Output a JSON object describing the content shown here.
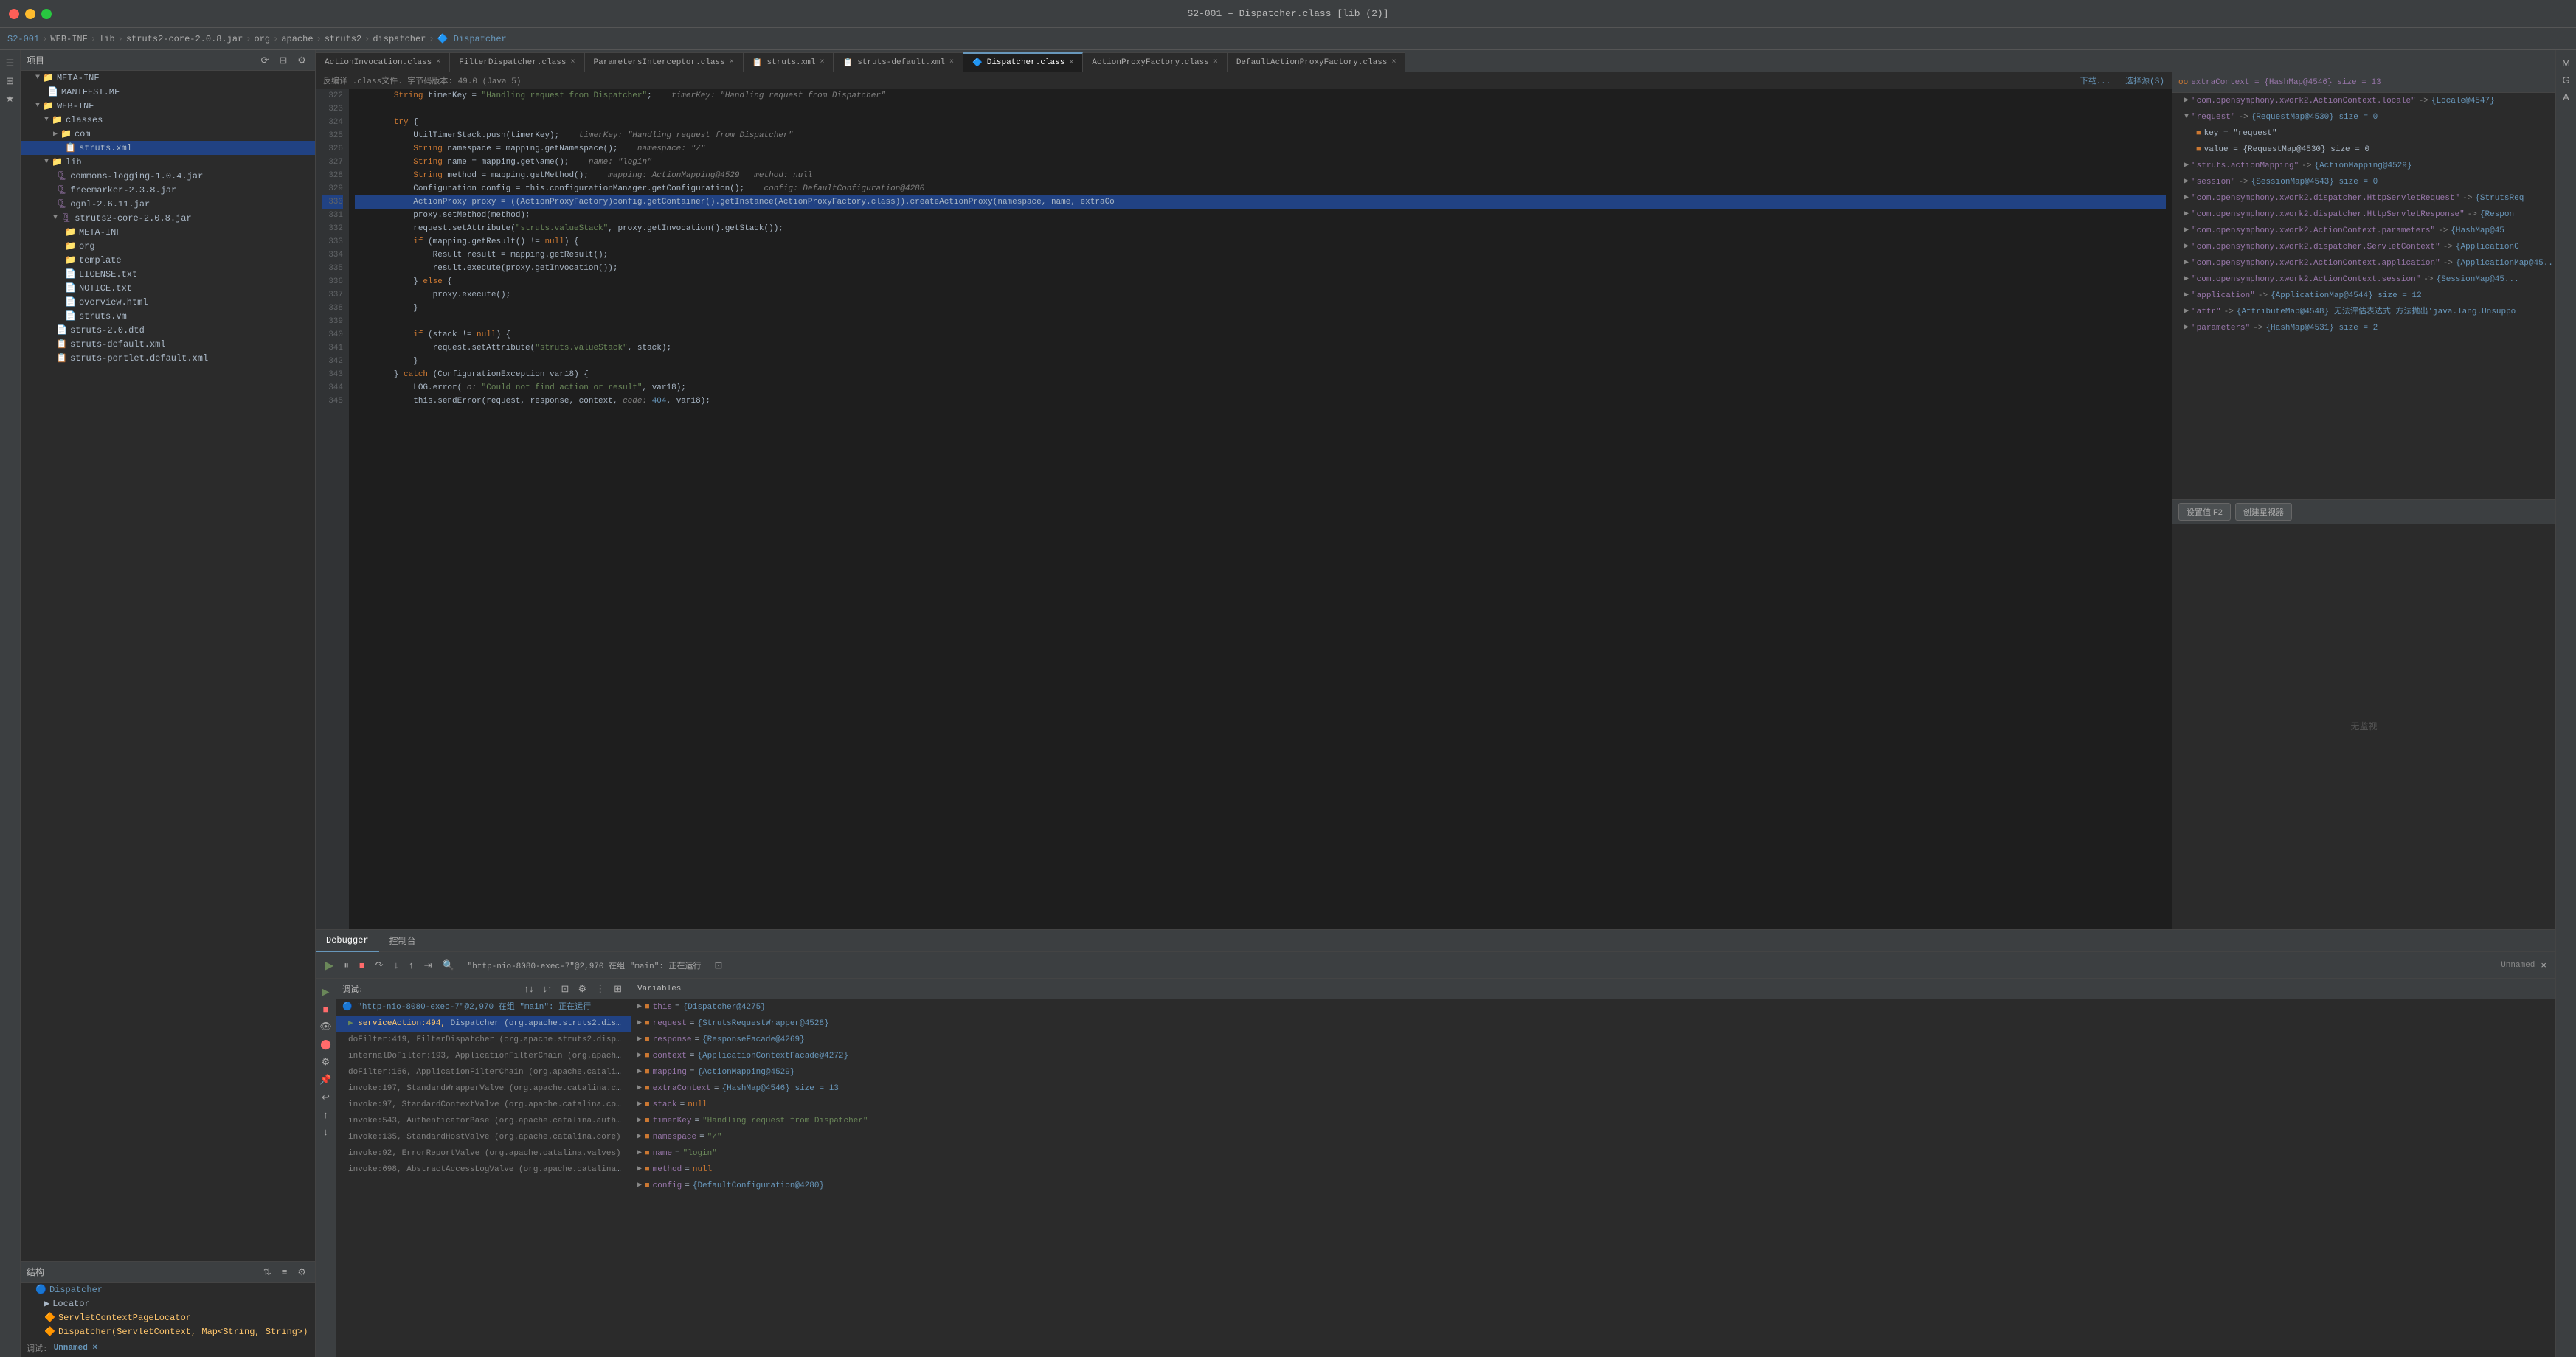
{
  "window": {
    "title": "S2-001 – Dispatcher.class [lib (2)]"
  },
  "breadcrumb": {
    "items": [
      "S2-001",
      "WEB-INF",
      "lib",
      "struts2-core-2.0.8.jar",
      "org",
      "apache",
      "struts2",
      "dispatcher",
      "Dispatcher"
    ]
  },
  "tabs": [
    {
      "label": "ActionInvocation.class",
      "active": false,
      "closeable": true
    },
    {
      "label": "FilterDispatcher.class",
      "active": false,
      "closeable": true
    },
    {
      "label": "ParametersInterceptor.class",
      "active": false,
      "closeable": true
    },
    {
      "label": "struts.xml",
      "active": false,
      "closeable": true
    },
    {
      "label": "struts-default.xml",
      "active": false,
      "closeable": true
    },
    {
      "label": "Dispatcher.class",
      "active": true,
      "closeable": true
    },
    {
      "label": "ActionProxyFactory.class",
      "active": false,
      "closeable": true
    },
    {
      "label": "DefaultActionProxyFactory.class",
      "active": false,
      "closeable": true
    }
  ],
  "editor": {
    "info_bar": "反编译 .class文件. 字节码版本: 49.0 (Java 5)",
    "info_bar_right": "下载...   选择源(S)",
    "lines": [
      {
        "num": 322,
        "content": "        String timerKey = \"Handling request from Dispatcher\";    timerKey: \"Handling request from Dispatcher\"",
        "highlight": false
      },
      {
        "num": 323,
        "content": "",
        "highlight": false
      },
      {
        "num": 324,
        "content": "        try {",
        "highlight": false
      },
      {
        "num": 325,
        "content": "            UtilTimerStack.push(timerKey);    timerKey: \"Handling request from Dispatcher\"",
        "highlight": false
      },
      {
        "num": 326,
        "content": "            String namespace = mapping.getNamespace();    namespace: \"/\"",
        "highlight": false
      },
      {
        "num": 327,
        "content": "            String name = mapping.getName();    name: \"login\"",
        "highlight": false
      },
      {
        "num": 328,
        "content": "            String method = mapping.getMethod();    mapping: ActionMapping@4529   method: null",
        "highlight": false
      },
      {
        "num": 329,
        "content": "            Configuration config = this.configurationManager.getConfiguration();    config: DefaultConfiguration@4280",
        "highlight": false
      },
      {
        "num": 330,
        "content": "            ActionProxy proxy = ((ActionProxyFactory)config.getContainer().getInstance(ActionProxyFactory.class)).createActionProxy(namespace, name, extraCo",
        "highlight": true
      },
      {
        "num": 331,
        "content": "            proxy.setMethod(method);",
        "highlight": false
      },
      {
        "num": 332,
        "content": "            request.setAttribute(\"struts.valueStack\", proxy.getInvocation().getStack());",
        "highlight": false
      },
      {
        "num": 333,
        "content": "            if (mapping.getResult() != null) {",
        "highlight": false
      },
      {
        "num": 334,
        "content": "                Result result = mapping.getResult();",
        "highlight": false
      },
      {
        "num": 335,
        "content": "                result.execute(proxy.getInvocation());",
        "highlight": false
      },
      {
        "num": 336,
        "content": "            } else {",
        "highlight": false
      },
      {
        "num": 337,
        "content": "                proxy.execute();",
        "highlight": false
      },
      {
        "num": 338,
        "content": "            }",
        "highlight": false
      },
      {
        "num": 339,
        "content": "",
        "highlight": false
      },
      {
        "num": 340,
        "content": "            if (stack != null) {",
        "highlight": false
      },
      {
        "num": 341,
        "content": "                request.setAttribute(\"struts.valueStack\", stack);",
        "highlight": false
      },
      {
        "num": 342,
        "content": "            }",
        "highlight": false
      },
      {
        "num": 343,
        "content": "        } catch (ConfigurationException var18) {",
        "highlight": false
      },
      {
        "num": 344,
        "content": "            LOG.error( o: \"Could not find action or result\", var18);",
        "highlight": false
      },
      {
        "num": 345,
        "content": "            this.sendError(request, response, context, code: 404, var18);",
        "highlight": false
      }
    ]
  },
  "debug_panel": {
    "header": "oo extraContext = {HashMap@4546} size = 13",
    "items": [
      {
        "indent": 0,
        "expanded": true,
        "key": "oo extraContext = {HashMap@4546} size = 13",
        "value": ""
      },
      {
        "indent": 1,
        "expanded": false,
        "key": "\"com.opensymphony.xwork2.ActionContext.locale\"",
        "value": "-> {Locale@4547}"
      },
      {
        "indent": 1,
        "expanded": true,
        "key": "\"request\"",
        "value": "-> {RequestMap@4530} size = 0"
      },
      {
        "indent": 2,
        "expanded": false,
        "key": "key = \"request\"",
        "value": ""
      },
      {
        "indent": 2,
        "expanded": false,
        "key": "value = {RequestMap@4530} size = 0",
        "value": ""
      },
      {
        "indent": 1,
        "expanded": false,
        "key": "\"struts.actionMapping\"",
        "value": "-> {ActionMapping@4529}"
      },
      {
        "indent": 1,
        "expanded": false,
        "key": "\"session\"",
        "value": "-> {SessionMap@4543} size = 0"
      },
      {
        "indent": 1,
        "expanded": false,
        "key": "\"com.opensymphony.xwork2.dispatcher.HttpServletRequest\"",
        "value": "-> {StrutsReq"
      },
      {
        "indent": 1,
        "expanded": false,
        "key": "\"com.opensymphony.xwork2.dispatcher.HttpServletResponse\"",
        "value": "-> {Respon"
      },
      {
        "indent": 1,
        "expanded": false,
        "key": "\"com.opensymphony.xwork2.ActionContext.parameters\"",
        "value": "-> {HashMap@45"
      },
      {
        "indent": 1,
        "expanded": false,
        "key": "\"com.opensymphony.xwork2.dispatcher.ServletContext\"",
        "value": "-> {ApplicationC"
      },
      {
        "indent": 1,
        "expanded": false,
        "key": "\"com.opensymphony.xwork2.ActionContext.application\"",
        "value": "-> {ApplicationMap@45..."
      },
      {
        "indent": 1,
        "expanded": false,
        "key": "\"com.opensymphony.xwork2.ActionContext.session\"",
        "value": "-> {SessionMap@45..."
      },
      {
        "indent": 1,
        "expanded": false,
        "key": "\"application\"",
        "value": "-> {ApplicationMap@4544} size = 12"
      },
      {
        "indent": 1,
        "expanded": false,
        "key": "\"attr\"",
        "value": "-> {AttributeMap@4548} 无法评估表达式 方法抛出'java.lang.Unsuppo"
      },
      {
        "indent": 1,
        "expanded": false,
        "key": "\"parameters\"",
        "value": "-> {HashMap@4531} size = 2"
      }
    ],
    "actions": [
      {
        "label": "设置值 F2"
      },
      {
        "label": "创建星视器"
      }
    ]
  },
  "bottom_panel": {
    "tabs": [
      "Debugger",
      "控制台"
    ],
    "active_tab": "Debugger",
    "debug_toolbar": {
      "thread_label": "\"http-nio-8080-exec-7\"@2,970 在组 \"main\": 正在运行"
    },
    "call_stack": {
      "items": [
        {
          "method": "serviceAction:494",
          "class": "Dispatcher (org.apache.struts2.dispatcher)",
          "selected": true
        },
        {
          "method": "doFilter:419",
          "class": "FilterDispatcher (org.apache.struts2.dispatcher)",
          "selected": false
        },
        {
          "method": "internalDoFilter:193",
          "class": "ApplicationFilterChain (org.apache.catalina.co...",
          "selected": false
        },
        {
          "method": "doFilter:166",
          "class": "ApplicationFilterChain (org.apache.catalina.core)",
          "selected": false
        },
        {
          "method": "invoke:197",
          "class": "StandardWrapperValve (org.apache.catalina.core)",
          "selected": false
        },
        {
          "method": "invoke:97",
          "class": "StandardContextValve (org.apache.catalina.core)",
          "selected": false
        },
        {
          "method": "invoke:543",
          "class": "AuthenticatorBase (org.apache.catalina.authenticator)",
          "selected": false
        },
        {
          "method": "invoke:135",
          "class": "StandardHostValve (org.apache.catalina.core)",
          "selected": false
        },
        {
          "method": "invoke:92",
          "class": "ErrorReportValve (org.apache.catalina.valves)",
          "selected": false
        },
        {
          "method": "invoke:698",
          "class": "AbstractAccessLogValve (org.apache.catalina.valves)",
          "selected": false
        }
      ]
    },
    "variables": {
      "items": [
        {
          "indent": 0,
          "name": "this",
          "value": "= {Dispatcher@4275}"
        },
        {
          "indent": 0,
          "name": "request",
          "value": "= {StrutsRequestWrapper@4528}"
        },
        {
          "indent": 0,
          "name": "response",
          "value": "= {ResponseFacade@4269}"
        },
        {
          "indent": 0,
          "name": "context",
          "value": "= {ApplicationContextFacade@4272}"
        },
        {
          "indent": 0,
          "name": "mapping",
          "value": "= {ActionMapping@4529}"
        },
        {
          "indent": 0,
          "name": "extraContext",
          "value": "= {HashMap@4546} size = 13"
        },
        {
          "indent": 0,
          "name": "stack",
          "value": "= null"
        },
        {
          "indent": 0,
          "name": "timerKey",
          "value": "= \"Handling request from Dispatcher\""
        },
        {
          "indent": 0,
          "name": "namespace",
          "value": "= \"/\""
        },
        {
          "indent": 0,
          "name": "name",
          "value": "= \"login\""
        },
        {
          "indent": 0,
          "name": "method",
          "value": "= null"
        },
        {
          "indent": 0,
          "name": "config",
          "value": "= {DefaultConfiguration@4280}"
        }
      ]
    }
  },
  "sidebar": {
    "project_header": "项目",
    "tree": [
      {
        "indent": 0,
        "label": "META-INF",
        "type": "folder",
        "expanded": true
      },
      {
        "indent": 1,
        "label": "MANIFEST.MF",
        "type": "file"
      },
      {
        "indent": 0,
        "label": "WEB-INF",
        "type": "folder",
        "expanded": true
      },
      {
        "indent": 1,
        "label": "classes",
        "type": "folder",
        "expanded": true
      },
      {
        "indent": 2,
        "label": "com",
        "type": "folder",
        "expanded": true
      },
      {
        "indent": 3,
        "label": "struts.xml",
        "type": "xml"
      },
      {
        "indent": 1,
        "label": "lib",
        "type": "folder",
        "expanded": true
      },
      {
        "indent": 2,
        "label": "commons-logging-1.0.4.jar",
        "type": "jar"
      },
      {
        "indent": 2,
        "label": "freemarker-2.3.8.jar",
        "type": "jar"
      },
      {
        "indent": 2,
        "label": "ognl-2.6.11.jar",
        "type": "jar"
      },
      {
        "indent": 2,
        "label": "struts2-core-2.0.8.jar",
        "type": "jar",
        "expanded": true
      },
      {
        "indent": 3,
        "label": "META-INF",
        "type": "folder"
      },
      {
        "indent": 3,
        "label": "org",
        "type": "folder"
      },
      {
        "indent": 3,
        "label": "template",
        "type": "folder"
      },
      {
        "indent": 3,
        "label": "LICENSE.txt",
        "type": "file"
      },
      {
        "indent": 3,
        "label": "NOTICE.txt",
        "type": "file"
      },
      {
        "indent": 3,
        "label": "overview.html",
        "type": "file"
      },
      {
        "indent": 3,
        "label": "struts.vm",
        "type": "file"
      },
      {
        "indent": 2,
        "label": "struts-2.0.dtd",
        "type": "file"
      },
      {
        "indent": 2,
        "label": "struts-default.xml",
        "type": "xml"
      },
      {
        "indent": 2,
        "label": "struts-portlet.default.xml",
        "type": "xml"
      }
    ],
    "structure_header": "结构",
    "structure_tree": [
      {
        "indent": 0,
        "label": "Dispatcher",
        "type": "class"
      },
      {
        "indent": 1,
        "label": "Locator",
        "type": "method"
      },
      {
        "indent": 1,
        "label": "ServletContextPageLocator",
        "type": "class"
      },
      {
        "indent": 1,
        "label": "Dispatcher(ServletContext, Map<String, String>)",
        "type": "method"
      }
    ]
  },
  "status": {
    "debug_label": "调试:",
    "unnamed_label": "Unnamed",
    "no_monitor": "无监视"
  }
}
